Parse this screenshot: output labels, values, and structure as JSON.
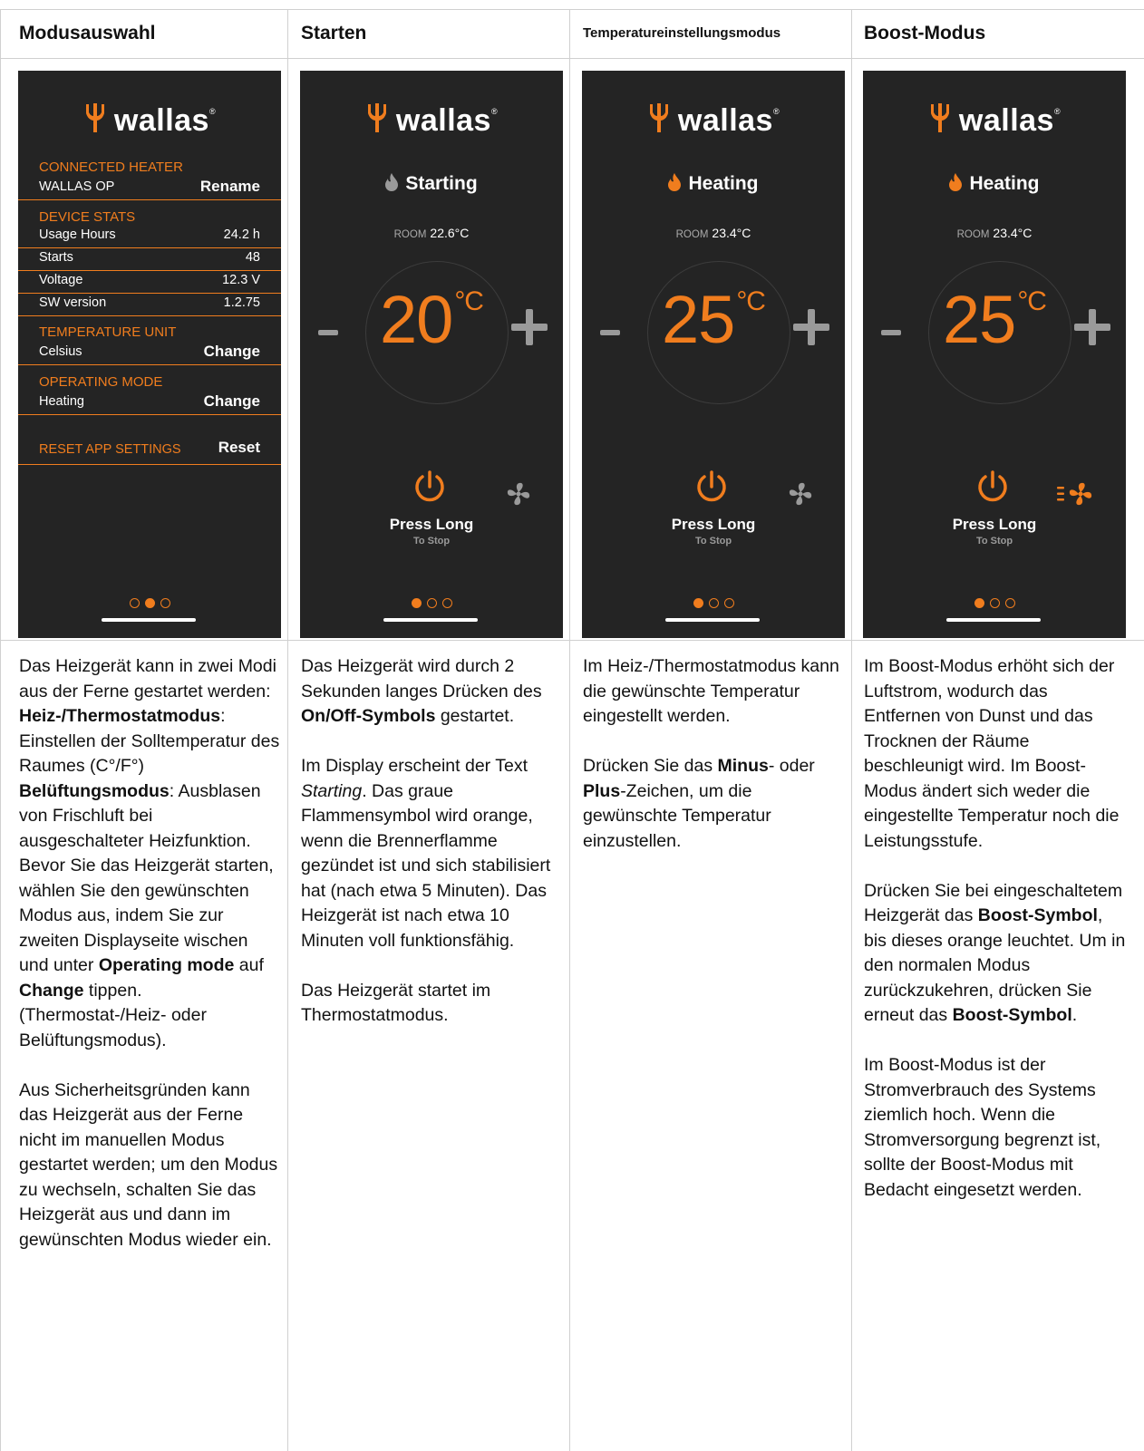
{
  "columns": [
    {
      "header": "Modusauswahl"
    },
    {
      "header": "Starten"
    },
    {
      "header": "Temperatureinstellungsmodus"
    },
    {
      "header": "Boost-Modus"
    }
  ],
  "brand": {
    "name": "wallas",
    "reg": "®",
    "accent": "#f07d1e",
    "screen_bg": "#242424"
  },
  "settings_screen": {
    "connected_heater": {
      "title": "CONNECTED HEATER",
      "label": "WALLAS OP",
      "action": "Rename"
    },
    "device_stats": {
      "title": "DEVICE STATS",
      "rows": [
        {
          "label": "Usage Hours",
          "value": "24.2 h"
        },
        {
          "label": "Starts",
          "value": "48"
        },
        {
          "label": "Voltage",
          "value": "12.3 V"
        },
        {
          "label": "SW version",
          "value": "1.2.75"
        }
      ]
    },
    "temperature_unit": {
      "title": "TEMPERATURE UNIT",
      "label": "Celsius",
      "action": "Change"
    },
    "operating_mode": {
      "title": "OPERATING MODE",
      "label": "Heating",
      "action": "Change"
    },
    "reset": {
      "label": "RESET APP SETTINGS",
      "action": "Reset"
    },
    "page_indicator": {
      "active": 2,
      "total": 3
    }
  },
  "heater_screens": [
    {
      "status": "Starting",
      "flame_color": "#9a9a9a",
      "room_label": "ROOM",
      "room_temp": "22.6°C",
      "set_temp": "20",
      "unit": "°C",
      "press": "Press Long",
      "press_sub": "To Stop",
      "boost_active": false,
      "page_indicator": {
        "active": 1,
        "total": 3
      }
    },
    {
      "status": "Heating",
      "flame_color": "#f07d1e",
      "room_label": "ROOM",
      "room_temp": "23.4°C",
      "set_temp": "25",
      "unit": "°C",
      "press": "Press Long",
      "press_sub": "To Stop",
      "boost_active": false,
      "page_indicator": {
        "active": 1,
        "total": 3
      }
    },
    {
      "status": "Heating",
      "flame_color": "#f07d1e",
      "room_label": "ROOM",
      "room_temp": "23.4°C",
      "set_temp": "25",
      "unit": "°C",
      "press": "Press Long",
      "press_sub": "To Stop",
      "boost_active": true,
      "page_indicator": {
        "active": 1,
        "total": 3
      }
    }
  ],
  "descriptions": {
    "col1": {
      "p1": [
        {
          "t": "Das Heizgerät kann in zwei Modi aus der Ferne gestartet werden:"
        },
        {
          "br": true
        },
        {
          "t": "Heiz-/Thermostatmodus",
          "b": true
        },
        {
          "t": ": Einstellen der Solltemperatur des Raumes (C°/F°)"
        },
        {
          "br": true
        },
        {
          "t": "Belüftungsmodus",
          "b": true
        },
        {
          "t": ": Ausblasen"
        },
        {
          "br": true
        },
        {
          "t": "von Frischluft bei ausgeschalteter Heizfunktion. Bevor Sie das Heizgerät starten, wählen Sie den gewünschten Modus aus, indem Sie zur zweiten Displayseite wischen und unter "
        },
        {
          "t": "Operating mode",
          "b": true
        },
        {
          "t": " auf "
        },
        {
          "t": "Change",
          "b": true
        },
        {
          "t": " tippen. (Thermostat-/Heiz- oder Belüftungsmodus)."
        }
      ],
      "p2": [
        {
          "t": "Aus Sicherheitsgründen kann das Heizgerät aus der Ferne nicht im manuellen Modus gestartet werden; um den Modus zu wechseln, schalten Sie das Heizgerät aus und dann im gewünschten Modus wieder ein."
        }
      ]
    },
    "col2": {
      "p1": [
        {
          "t": "Das Heizgerät wird durch 2 Sekunden langes Drücken des "
        },
        {
          "t": "On/Off-Symbols",
          "b": true
        },
        {
          "t": " gestartet."
        }
      ],
      "p2": [
        {
          "t": "Im Display erscheint der Text "
        },
        {
          "t": "Starting",
          "i": true
        },
        {
          "t": ". Das graue Flammensymbol wird orange, wenn die Brennerflamme gezündet ist und sich stabilisiert hat (nach etwa 5 Minuten). Das Heizgerät ist nach etwa 10 Minuten voll funktionsfähig."
        }
      ],
      "p3": [
        {
          "t": "Das Heizgerät startet im Thermostatmodus."
        }
      ]
    },
    "col3": {
      "p1": [
        {
          "t": "Im Heiz-/Thermostatmodus kann die gewünschte Temperatur eingestellt werden."
        }
      ],
      "p2": [
        {
          "t": "Drücken Sie das "
        },
        {
          "t": "Minus",
          "b": true
        },
        {
          "t": "- oder "
        },
        {
          "t": "Plus",
          "b": true
        },
        {
          "t": "-Zeichen, um die gewünschte Temperatur einzustellen."
        }
      ]
    },
    "col4": {
      "p1": [
        {
          "t": "Im Boost-Modus erhöht sich der Luftstrom, wodurch das Entfernen von Dunst und das Trocknen der Räume beschleunigt wird. Im Boost-Modus ändert sich weder die eingestellte Temperatur noch die Leistungsstufe."
        }
      ],
      "p2": [
        {
          "t": "Drücken Sie bei eingeschaltetem Heizgerät das "
        },
        {
          "t": "Boost-Symbol",
          "b": true
        },
        {
          "t": ", bis dieses orange leuchtet. Um in den normalen Modus zurückzukehren, drücken Sie erneut das "
        },
        {
          "t": "Boost-Symbol",
          "b": true
        },
        {
          "t": "."
        }
      ],
      "p3": [
        {
          "t": "Im Boost-Modus ist der Stromverbrauch des Systems ziemlich hoch. Wenn die Stromversorgung begrenzt ist, sollte der Boost-Modus mit Bedacht eingesetzt werden."
        }
      ]
    }
  }
}
